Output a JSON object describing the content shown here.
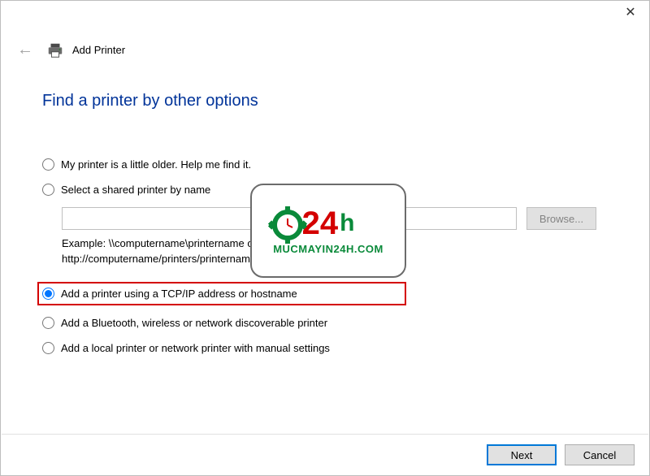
{
  "window": {
    "title": "Add Printer",
    "close_glyph": "✕"
  },
  "heading": "Find a printer by other options",
  "options": {
    "older": {
      "label": "My printer is a little older. Help me find it."
    },
    "shared": {
      "label": "Select a shared printer by name",
      "input_value": "",
      "browse_label": "Browse...",
      "example_line1": "Example: \\\\computername\\printername or",
      "example_line2": "http://computername/printers/printername/.printer"
    },
    "tcpip": {
      "label": "Add a printer using a TCP/IP address or hostname",
      "selected": true
    },
    "bluetooth": {
      "label": "Add a Bluetooth, wireless or network discoverable printer"
    },
    "manual": {
      "label": "Add a local printer or network printer with manual settings"
    }
  },
  "watermark": {
    "num": "24",
    "h": "h",
    "url": "MUCMAYIN24H.COM"
  },
  "footer": {
    "next_label": "Next",
    "cancel_label": "Cancel"
  }
}
